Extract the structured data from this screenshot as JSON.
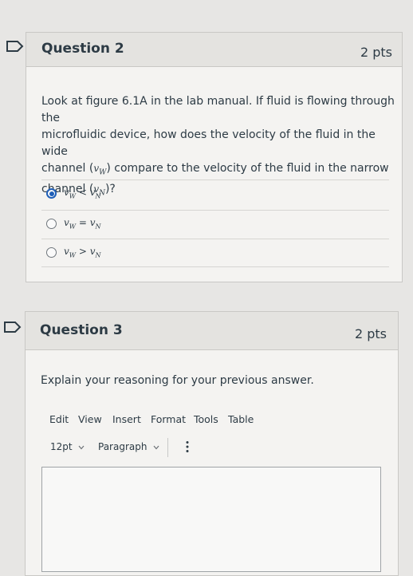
{
  "questions": [
    {
      "title": "Question 2",
      "points": "2 pts",
      "prompt": {
        "line1": "Look at figure 6.1A in the lab manual. If fluid is flowing through the",
        "line2": "microfluidic device, how does the velocity of the fluid in the wide",
        "line3a": "channel (",
        "line3_var": "v",
        "line3_sub": "W",
        "line3b": ") compare to the velocity of the fluid in the narrow",
        "line4a": "channel (",
        "line4_var": "v",
        "line4_sub": "N",
        "line4b": ")?"
      },
      "answers": [
        {
          "label": "vW < vN",
          "selected": true
        },
        {
          "label": "vW = vN",
          "selected": false
        },
        {
          "label": "vW > vN",
          "selected": false
        }
      ]
    },
    {
      "title": "Question 3",
      "points": "2 pts",
      "prompt": "Explain your reasoning for your previous answer.",
      "editor": {
        "menu": [
          "Edit",
          "View",
          "Insert",
          "Format",
          "Tools",
          "Table"
        ],
        "font_size": "12pt",
        "block_format": "Paragraph",
        "more_icon": "more-vertical-icon"
      }
    }
  ],
  "colors": {
    "selected_radio": "#1f5fb8",
    "background": "#e7e6e4"
  }
}
